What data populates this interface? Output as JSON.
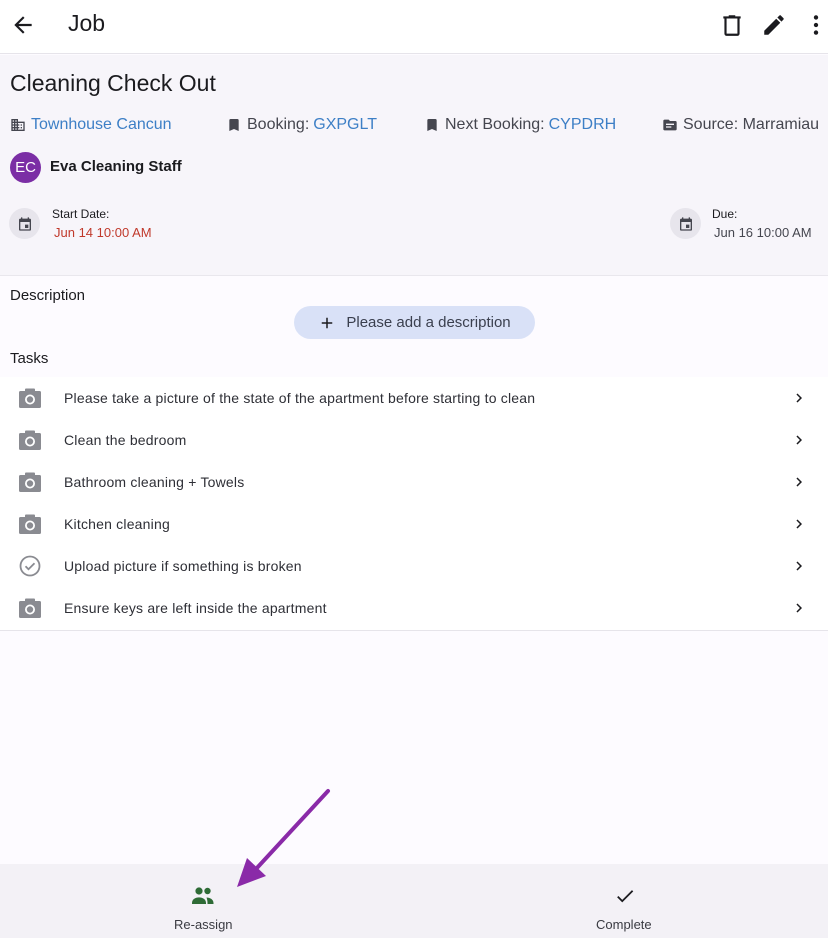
{
  "appbar": {
    "title": "Job",
    "icons": [
      "back-arrow-icon",
      "delete-icon",
      "edit-icon",
      "more-vert-icon"
    ]
  },
  "job": {
    "title": "Cleaning Check Out",
    "property": "Townhouse Cancun",
    "booking_label": "Booking: ",
    "booking_code": "GXPGLT",
    "next_booking_label": "Next Booking: ",
    "next_booking_code": "CYPDRH",
    "source": "Source: Marramiau",
    "assignee_initials": "EC",
    "assignee_name": "Eva Cleaning Staff",
    "start_label": "Start Date:",
    "start_value": "Jun 14 10:00 AM",
    "due_label": "Due:",
    "due_value": "Jun 16 10:00 AM"
  },
  "description": {
    "label": "Description",
    "add_button": "Please add a description"
  },
  "tasks": {
    "label": "Tasks",
    "items": [
      {
        "label": "Please take a picture of the state of the apartment before starting to clean",
        "icon": "camera-icon"
      },
      {
        "label": "Clean the bedroom",
        "icon": "camera-icon"
      },
      {
        "label": "Bathroom cleaning + Towels",
        "icon": "camera-icon"
      },
      {
        "label": "Kitchen cleaning",
        "icon": "camera-icon"
      },
      {
        "label": "Upload picture if something is broken",
        "icon": "check-circle-icon"
      },
      {
        "label": "Ensure keys are left inside the apartment",
        "icon": "camera-icon"
      }
    ]
  },
  "bottombar": {
    "reassign": "Re-assign",
    "complete": "Complete"
  },
  "colors": {
    "link": "#3d7fc6",
    "start_date": "#c0392b",
    "avatar": "#7b2ea5",
    "reassign_icon": "#2e6b36",
    "annotation_arrow": "#8a2aa8",
    "add_button_bg": "#d9e1f7"
  }
}
